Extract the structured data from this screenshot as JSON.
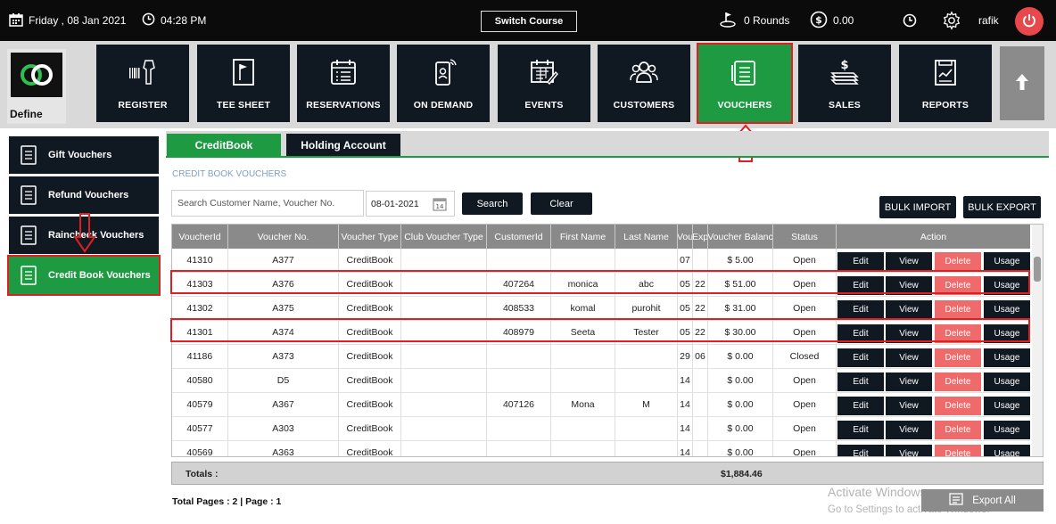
{
  "topbar": {
    "date": "Friday , 08 Jan 2021",
    "time": "04:28 PM",
    "switch_course": "Switch Course",
    "rounds": "0 Rounds",
    "amount": "0.00",
    "user": "rafik"
  },
  "define": {
    "label": "Define"
  },
  "nav": [
    {
      "label": "REGISTER",
      "icon": "barcode-scanner-icon"
    },
    {
      "label": "TEE SHEET",
      "icon": "flag-icon"
    },
    {
      "label": "RESERVATIONS",
      "icon": "calendar-list-icon"
    },
    {
      "label": "ON DEMAND",
      "icon": "mobile-icon"
    },
    {
      "label": "EVENTS",
      "icon": "calendar-edit-icon"
    },
    {
      "label": "CUSTOMERS",
      "icon": "users-icon"
    },
    {
      "label": "VOUCHERS",
      "icon": "voucher-icon"
    },
    {
      "label": "SALES",
      "icon": "money-icon"
    },
    {
      "label": "REPORTS",
      "icon": "report-icon"
    }
  ],
  "sidebar": [
    {
      "label": "Gift Vouchers"
    },
    {
      "label": "Refund Vouchers"
    },
    {
      "label": "Raincheck Vouchers"
    },
    {
      "label": "Credit Book Vouchers"
    }
  ],
  "tabs": [
    {
      "label": "CreditBook"
    },
    {
      "label": "Holding Account"
    }
  ],
  "section_title": "CREDIT BOOK VOUCHERS",
  "search": {
    "placeholder": "Search Customer Name, Voucher No.",
    "date": "08-01-2021",
    "search_btn": "Search",
    "clear_btn": "Clear",
    "bulk_import": "BULK IMPORT",
    "bulk_export": "BULK EXPORT"
  },
  "table": {
    "headers": [
      "VoucherId",
      "Voucher No.",
      "Voucher Type",
      "Club Voucher Type",
      "CustomerId",
      "First Name",
      "Last Name",
      "Vou",
      "Exp",
      "Voucher Balanc",
      "Status",
      "Action"
    ],
    "actions": {
      "edit": "Edit",
      "view": "View",
      "delete": "Delete",
      "usage": "Usage"
    },
    "rows": [
      [
        "41310",
        "A377",
        "CreditBook",
        "",
        "",
        "",
        "",
        "07",
        "",
        "$ 5.00",
        "Open"
      ],
      [
        "41303",
        "A376",
        "CreditBook",
        "",
        "407264",
        "monica",
        "abc",
        "05",
        "22",
        "$ 51.00",
        "Open"
      ],
      [
        "41302",
        "A375",
        "CreditBook",
        "",
        "408533",
        "komal",
        "purohit",
        "05",
        "22",
        "$ 31.00",
        "Open"
      ],
      [
        "41301",
        "A374",
        "CreditBook",
        "",
        "408979",
        "Seeta",
        "Tester",
        "05",
        "22",
        "$ 30.00",
        "Open"
      ],
      [
        "41186",
        "A373",
        "CreditBook",
        "",
        "",
        "",
        "",
        "29",
        "06",
        "$ 0.00",
        "Closed"
      ],
      [
        "40580",
        "D5",
        "CreditBook",
        "",
        "",
        "",
        "",
        "14",
        "",
        "$ 0.00",
        "Open"
      ],
      [
        "40579",
        "A367",
        "CreditBook",
        "",
        "407126",
        "Mona",
        "M",
        "14",
        "",
        "$ 0.00",
        "Open"
      ],
      [
        "40577",
        "A303",
        "CreditBook",
        "",
        "",
        "",
        "",
        "14",
        "",
        "$ 0.00",
        "Open"
      ],
      [
        "40569",
        "A363",
        "CreditBook",
        "",
        "",
        "",
        "",
        "14",
        "",
        "$ 0.00",
        "Open"
      ]
    ]
  },
  "totals": {
    "label": "Totals :",
    "amount": "$1,884.46"
  },
  "pages": "Total Pages : 2 | Page : 1",
  "watermark": {
    "line1": "Activate Windows",
    "line2": "Go to Settings to activate Windows."
  },
  "export_all": "Export All"
}
